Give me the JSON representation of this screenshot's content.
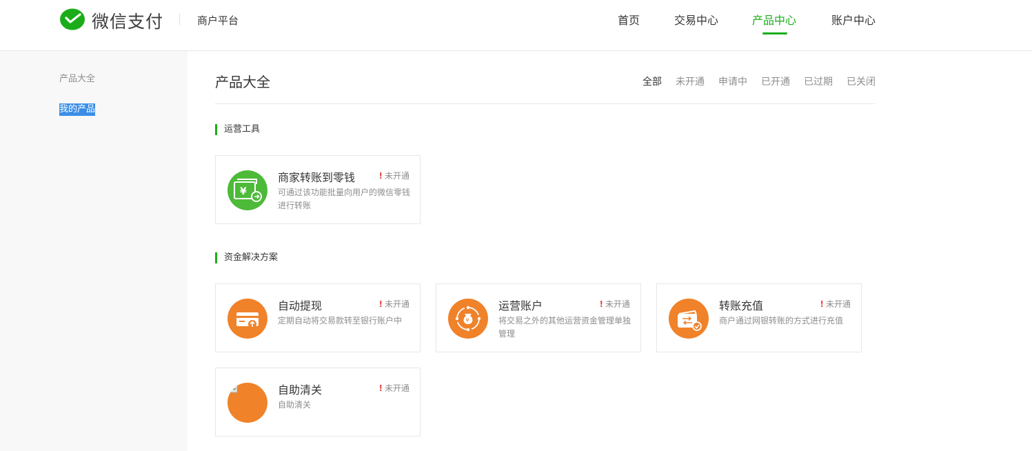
{
  "header": {
    "brand": "微信支付",
    "platform": "商户平台",
    "nav": [
      "首页",
      "交易中心",
      "产品中心",
      "账户中心"
    ],
    "active_nav": "产品中心"
  },
  "sidebar": {
    "items": [
      "产品大全",
      "我的产品"
    ],
    "active_item": "我的产品"
  },
  "main": {
    "title": "产品大全",
    "filters": [
      "全部",
      "未开通",
      "申请中",
      "已开通",
      "已过期",
      "已关闭"
    ],
    "active_filter": "全部",
    "sections": [
      {
        "title": "运营工具",
        "cards": [
          {
            "name": "商家转账到零钱",
            "status": "未开通",
            "desc": "可通过该功能批量向用户的微信零钱进行转账",
            "icon": "wallet-transfer-icon",
            "icon_color": "#4dba39"
          }
        ]
      },
      {
        "title": "资金解决方案",
        "cards": [
          {
            "name": "自动提现",
            "status": "未开通",
            "desc": "定期自动将交易款转至银行账户中",
            "icon": "card-withdraw-icon",
            "icon_color": "#f0822a"
          },
          {
            "name": "运营账户",
            "status": "未开通",
            "desc": "将交易之外的其他运营资金管理单独管理",
            "icon": "money-bag-icon",
            "icon_color": "#f0822a"
          },
          {
            "name": "转账充值",
            "status": "未开通",
            "desc": "商户通过网银转账的方式进行充值",
            "icon": "wallet-recharge-icon",
            "icon_color": "#f0822a"
          },
          {
            "name": "自助清关",
            "status": "未开通",
            "desc": "自助清关",
            "icon": "broken-image-icon",
            "icon_color": "#f0822a"
          }
        ]
      }
    ]
  },
  "colors": {
    "accent": "#1aad19",
    "selection": "#3a8ee6",
    "warning": "#e64340"
  }
}
